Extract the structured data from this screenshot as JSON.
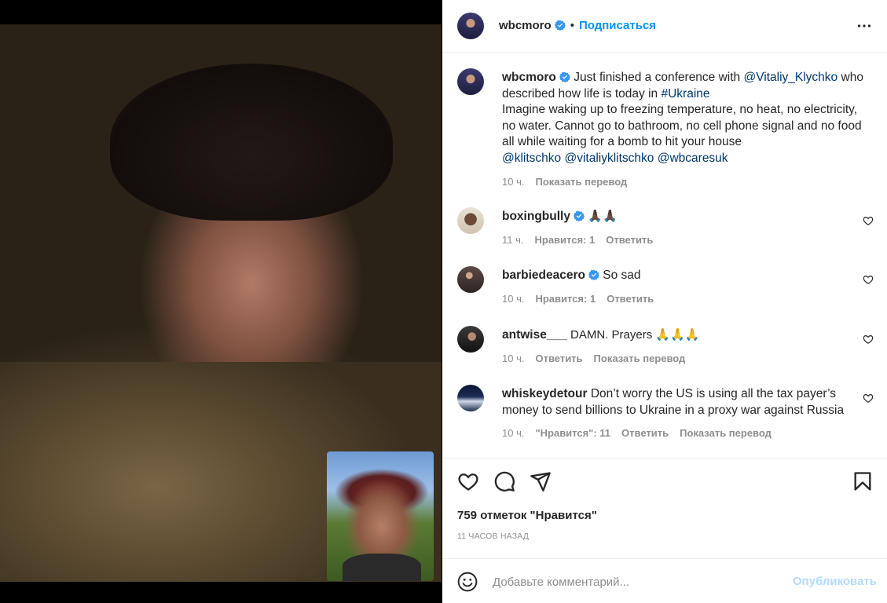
{
  "post": {
    "author": "wbcmoro",
    "follow_label": "Подписаться",
    "separator": "•",
    "caption": {
      "username": "wbcmoro",
      "text_1": "Just finished a conference with",
      "mention_1": "@Vitaliy_Klychko",
      "text_2": "who described how life is today in",
      "hashtag": "#Ukraine",
      "text_3": "Imagine waking up to freezing temperature, no heat, no electricity, no water. Cannot go to bathroom, no cell phone signal and no food all while waiting for a bomb to hit your house",
      "mention_2": "@klitschko",
      "mention_3": "@vitaliyklitschko",
      "mention_4": "@wbcaresuk",
      "time": "10 ч.",
      "translate": "Показать перевод"
    },
    "comments": [
      {
        "username": "boxingbully",
        "verified": true,
        "text": "🙏🏿🙏🏿",
        "time": "11 ч.",
        "likes": "Нравится: 1",
        "reply": "Ответить"
      },
      {
        "username": "barbiedeacero",
        "verified": true,
        "text": "So sad",
        "time": "10 ч.",
        "likes": "Нравится: 1",
        "reply": "Ответить"
      },
      {
        "username": "antwise___",
        "verified": false,
        "text": "DAMN. Prayers 🙏🙏🙏",
        "time": "10 ч.",
        "reply": "Ответить",
        "translate": "Показать перевод"
      },
      {
        "username": "whiskeydetour",
        "verified": false,
        "text": "Don’t worry the US is using all the tax payer’s money to send billions to Ukraine in a proxy war against Russia",
        "time": "10 ч.",
        "likes": "\"Нравится\": 11",
        "reply": "Ответить",
        "translate": "Показать перевод"
      }
    ],
    "likes_count": "759 отметок \"Нравится\"",
    "posted_ago": "11 ЧАСОВ НАЗАД",
    "composer": {
      "placeholder": "Добавьте комментарий...",
      "publish_label": "Опубликовать"
    }
  },
  "colors": {
    "accent": "#0095f6",
    "link": "#00376b",
    "muted": "#8e8e8e",
    "publish_disabled": "#b3dbff",
    "verified": "#3897f0"
  },
  "icons": [
    "verified-badge-icon",
    "more-options-icon",
    "heart-icon",
    "comment-icon",
    "share-icon",
    "bookmark-icon",
    "emoji-icon"
  ]
}
